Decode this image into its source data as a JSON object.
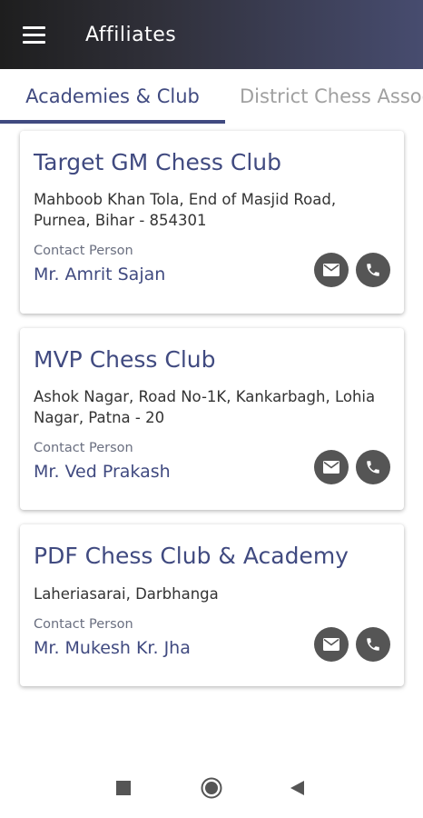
{
  "appbar": {
    "title": "Affiliates",
    "menu_icon": "hamburger-menu-icon"
  },
  "tabs": [
    {
      "label": "Academies & Club",
      "active": true
    },
    {
      "label": "District Chess Association",
      "active": false
    }
  ],
  "clubs": [
    {
      "name": "Target GM Chess Club",
      "address": "Mahboob Khan Tola, End of Masjid Road, Purnea, Bihar - 854301",
      "contact_label": "Contact Person",
      "contact_name": "Mr. Amrit Sajan"
    },
    {
      "name": "MVP Chess Club",
      "address": "Ashok Nagar, Road No-1K, Kankarbagh, Lohia Nagar, Patna - 20",
      "contact_label": "Contact Person",
      "contact_name": "Mr. Ved Prakash"
    },
    {
      "name": "PDF Chess Club & Academy",
      "address": "Laheriasarai, Darbhanga",
      "contact_label": "Contact Person",
      "contact_name": "Mr. Mukesh Kr. Jha"
    }
  ],
  "actions": {
    "email_icon": "email-icon",
    "phone_icon": "phone-icon"
  },
  "navbar": {
    "recents_icon": "square-recents-icon",
    "home_icon": "circle-home-icon",
    "back_icon": "triangle-back-icon"
  },
  "colors": {
    "accent": "#404a80",
    "action_bg": "#555555",
    "appbar_start": "#1e1e1e",
    "appbar_end": "#474c6f"
  }
}
